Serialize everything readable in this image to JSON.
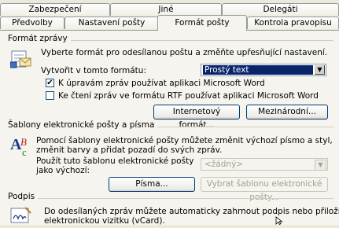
{
  "tabs_row1": [
    "Zabezpečení",
    "Jiné",
    "Delegáti"
  ],
  "tabs_row2": [
    "Předvolby",
    "Nastavení pošty",
    "Formát pošty",
    "Kontrola pravopisu"
  ],
  "format": {
    "section_title": "Formát zprávy",
    "description": "Vyberte formát pro odesílanou poštu a změňte upřesňující nastavení.",
    "compose_label": "Vytvořit v tomto formátu:",
    "compose_value": "Prostý text",
    "check1_label": "K úpravám zpráv používat aplikaci Microsoft Word",
    "check1_checked": true,
    "check2_label": "Ke čtení zpráv ve formátu RTF používat aplikaci Microsoft Word",
    "check2_checked": false,
    "internet_button": "Internetový formát...",
    "international_button": "Mezinárodní..."
  },
  "stationery": {
    "section_title": "Šablony elektronické pošty a písma",
    "description_line1": "Pomocí šablony elektronické pošty můžete změnit výchozí písmo a styl,",
    "description_line2": "změnit barvy a přidat pozadí do svých zpráv.",
    "use_label_line1": "Použít tuto šablonu elektronické pošty",
    "use_label_line2": "jako výchozí:",
    "template_value": "<žádný>",
    "fonts_button": "Písma...",
    "pick_button": "Vybrat šablonu elektronické pošty..."
  },
  "signature": {
    "section_title": "Podpis",
    "description_line1": "Do odesílaných zpráv můžete automaticky zahrnout podpis nebo přiložit",
    "description_line2": "elektronickou vizitku (vCard)."
  }
}
